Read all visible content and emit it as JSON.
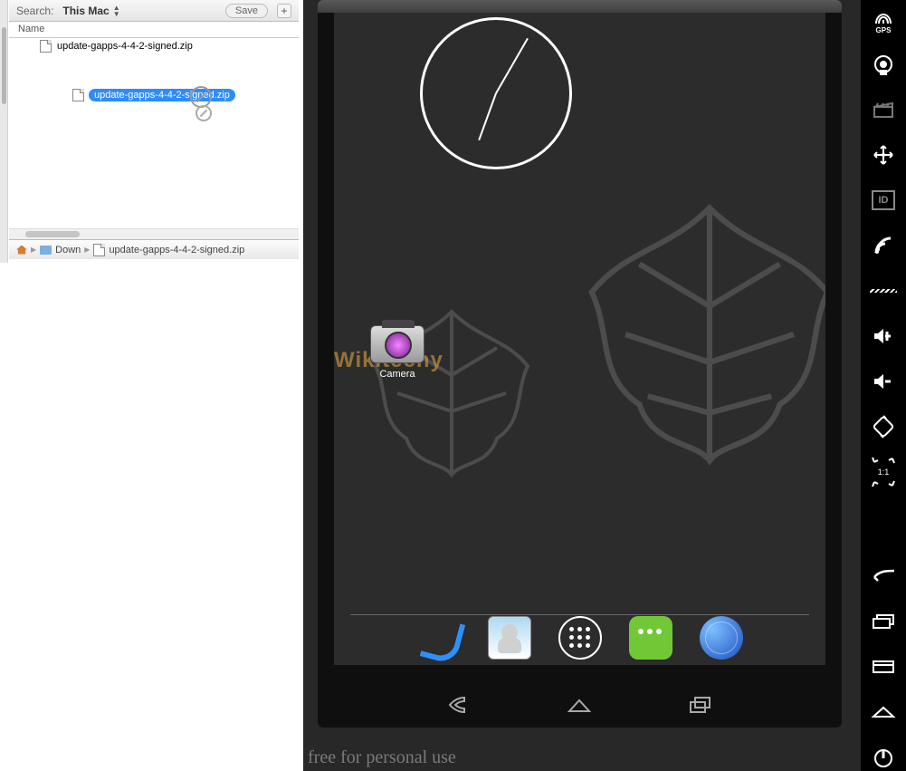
{
  "finder": {
    "search_label": "Search:",
    "scope": "This Mac",
    "save": "Save",
    "plus": "+",
    "column": "Name",
    "file_name": "update-gapps-4-4-2-signed.zip",
    "drag_name": "update-gapps-4-4-2-signed.zip",
    "path_downloads": "Down",
    "path_file": "update-gapps-4-4-2-signed.zip"
  },
  "android": {
    "camera_label": "Camera",
    "watermark": "Wikitechy"
  },
  "footer": "free for personal use",
  "sidebar": {
    "gps": "GPS",
    "id": "ID",
    "ratio": "1:1"
  }
}
